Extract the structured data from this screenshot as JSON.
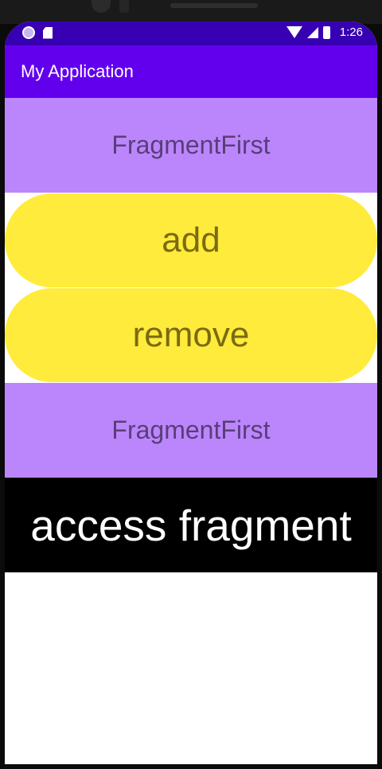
{
  "status_bar": {
    "time": "1:26",
    "left_icons": [
      "app-indicator-icon",
      "sd-card-icon"
    ],
    "right_icons": [
      "wifi-icon",
      "signal-icon",
      "battery-icon"
    ]
  },
  "app_bar": {
    "title": "My Application"
  },
  "fragments": [
    {
      "label": "FragmentFirst"
    },
    {
      "label": "FragmentFirst"
    }
  ],
  "buttons": {
    "add": "add",
    "remove": "remove",
    "access": "access fragment"
  },
  "colors": {
    "status_bar": "#3700b3",
    "app_bar": "#6200ee",
    "fragment_bg": "#bb86fc",
    "button_yellow": "#ffeb3b",
    "access_bg": "#000000"
  }
}
